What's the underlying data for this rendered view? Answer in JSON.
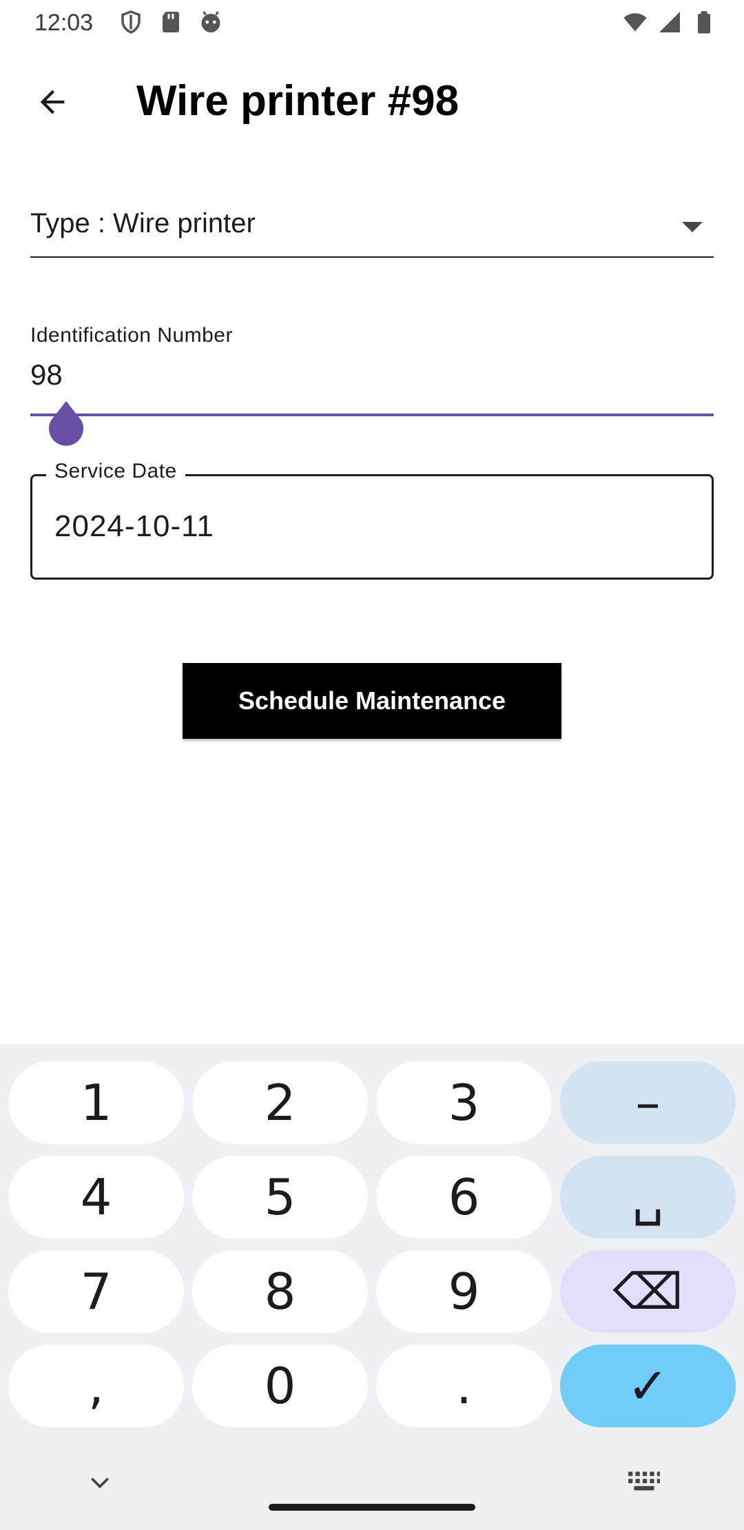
{
  "status_bar": {
    "time": "12:03",
    "left_icons": [
      "shield-icon",
      "sd-card-icon",
      "android-head-icon"
    ],
    "right_icons": [
      "wifi-icon",
      "signal-icon",
      "battery-icon"
    ]
  },
  "app_bar": {
    "title": "Wire printer #98",
    "back_icon": "arrow-back-icon"
  },
  "form": {
    "type_dropdown": {
      "text": "Type : Wire printer"
    },
    "identification": {
      "label": "Identification Number",
      "value": "98"
    },
    "service_date": {
      "label": "Service Date",
      "value": "2024-10-11"
    },
    "submit_label": "Schedule Maintenance"
  },
  "keyboard": {
    "rows": [
      [
        "1",
        "2",
        "3",
        "–"
      ],
      [
        "4",
        "5",
        "6",
        "␣"
      ],
      [
        "7",
        "8",
        "9",
        "⌫"
      ],
      [
        ",",
        "0",
        ".",
        "✓"
      ]
    ],
    "collapse_icon": "chevron-down-icon",
    "switch_icon": "keyboard-icon"
  },
  "colors": {
    "accent": "#6750a4",
    "keyboard_bg": "#eef0f4",
    "func_key": "#d3e3f2",
    "delete_key": "#e3defa",
    "enter_key": "#6fcdf7"
  }
}
